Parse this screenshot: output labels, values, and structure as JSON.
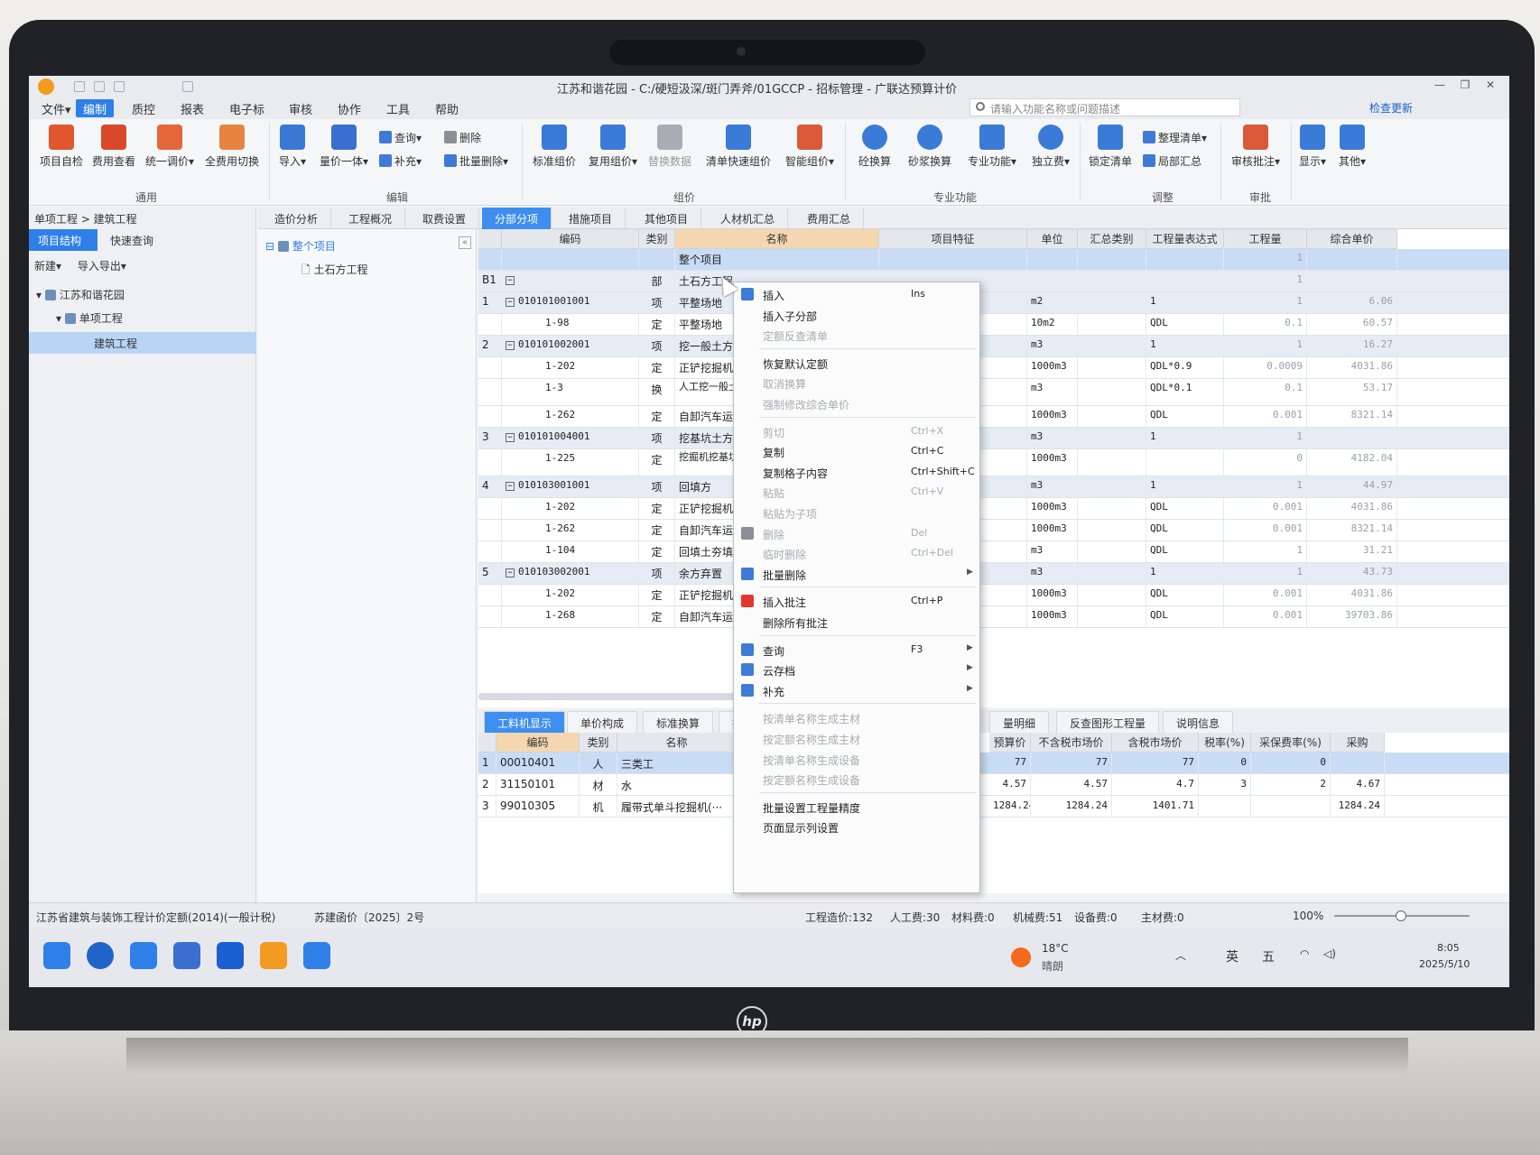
{
  "window": {
    "title": "江苏和谐花园 - C:/硬短汲深/斑门弄斧/01GCCP - 招标管理 - 广联达预算计价"
  },
  "menu": [
    "文件▾",
    "编制",
    "质控",
    "报表",
    "电子标",
    "审核",
    "协作",
    "工具",
    "帮助"
  ],
  "search": {
    "placeholder": "请输入功能名称或问题描述"
  },
  "update_label": "检查更新",
  "ribbon": {
    "tongyong": [
      "项目自检",
      "费用查看",
      "统一调价▾",
      "全费用切换"
    ],
    "import": "导入▾",
    "liangjia": "量价一体▾",
    "small_edit": [
      "查询▾",
      "补充▾",
      "删除",
      "批量删除▾"
    ],
    "zujia": [
      "标准组价",
      "复用组价▾",
      "替换数据",
      "清单快速组价",
      "智能组价▾"
    ],
    "zhuanye": [
      "砼换算",
      "砂浆换算",
      "专业功能▾",
      "独立费▾"
    ],
    "tiaozheng": [
      "锁定清单",
      "整理清单▾",
      "局部汇总"
    ],
    "shenpi": "审核批注▾",
    "view": [
      "显示▾",
      "其他▾"
    ],
    "groups": [
      "通用",
      "编辑",
      "组价",
      "专业功能",
      "调整",
      "审批"
    ]
  },
  "left": {
    "breadcrumb": "单项工程 > 建筑工程",
    "tabs": [
      "项目结构",
      "快速查询"
    ],
    "tools": [
      "新建▾",
      "导入导出▾"
    ],
    "tree": [
      "江苏和谐花园",
      "单项工程",
      "建筑工程"
    ]
  },
  "mid_tree": [
    "整个项目",
    "土石方工程"
  ],
  "doc_tabs": [
    "造价分析",
    "工程概况",
    "取费设置",
    "分部分项",
    "措施项目",
    "其他项目",
    "人材机汇总",
    "费用汇总"
  ],
  "grid": {
    "headers": [
      "编码",
      "类别",
      "名称",
      "项目特征",
      "单位",
      "汇总类别",
      "工程量表达式",
      "工程量",
      "综合单价"
    ],
    "rows": [
      {
        "no": "",
        "code": "",
        "cat": "",
        "name": "整个项目",
        "unit": "",
        "expr": "",
        "qty": "1",
        "price": "",
        "kind": "sel"
      },
      {
        "no": "B1",
        "code": "",
        "cat": "部",
        "name": "土石方工程",
        "unit": "",
        "expr": "",
        "qty": "1",
        "price": "",
        "kind": "summary"
      },
      {
        "no": "1",
        "code": "010101001001",
        "cat": "项",
        "name": "平整场地",
        "unit": "m2",
        "expr": "1",
        "qty": "1",
        "price": "6.06",
        "kind": "summary"
      },
      {
        "no": "",
        "code": "1-98",
        "cat": "定",
        "name": "平整场地",
        "unit": "10m2",
        "expr": "QDL",
        "qty": "0.1",
        "price": "60.57",
        "kind": ""
      },
      {
        "no": "2",
        "code": "010101002001",
        "cat": "项",
        "name": "挖一般土方",
        "unit": "m3",
        "expr": "1",
        "qty": "1",
        "price": "16.27",
        "kind": "summary"
      },
      {
        "no": "",
        "code": "1-202",
        "cat": "定",
        "name": "正铲挖掘机(1m3以",
        "unit": "1000m3",
        "expr": "QDL*0.9",
        "qty": "0.0009",
        "price": "4031.86",
        "kind": ""
      },
      {
        "no": "",
        "code": "1-3",
        "cat": "换",
        "name": "人工挖一般土方 坡、整平的土方工",
        "unit": "m3",
        "expr": "QDL*0.1",
        "qty": "0.1",
        "price": "53.17",
        "kind": "tall"
      },
      {
        "no": "",
        "code": "1-262",
        "cat": "定",
        "name": "自卸汽车运土运距",
        "unit": "1000m3",
        "expr": "QDL",
        "qty": "0.001",
        "price": "8321.14",
        "kind": ""
      },
      {
        "no": "3",
        "code": "010101004001",
        "cat": "项",
        "name": "挖基坑土方",
        "unit": "m3",
        "expr": "1",
        "qty": "1",
        "price": "",
        "kind": "summary"
      },
      {
        "no": "",
        "code": "1-225",
        "cat": "定",
        "name": "挖掘机挖基坑土 装车",
        "unit": "1000m3",
        "expr": "",
        "qty": "0",
        "price": "4182.04",
        "kind": "tall"
      },
      {
        "no": "4",
        "code": "010103001001",
        "cat": "项",
        "name": "回填方",
        "unit": "m3",
        "expr": "1",
        "qty": "1",
        "price": "44.97",
        "kind": "summary"
      },
      {
        "no": "",
        "code": "1-202",
        "cat": "定",
        "name": "正铲挖掘机(1m3以",
        "unit": "1000m3",
        "expr": "QDL",
        "qty": "0.001",
        "price": "4031.86",
        "kind": ""
      },
      {
        "no": "",
        "code": "1-262",
        "cat": "定",
        "name": "自卸汽车运土运距",
        "unit": "1000m3",
        "expr": "QDL",
        "qty": "0.001",
        "price": "8321.14",
        "kind": ""
      },
      {
        "no": "",
        "code": "1-104",
        "cat": "定",
        "name": "回填土夯填基(槽)",
        "unit": "m3",
        "expr": "QDL",
        "qty": "1",
        "price": "31.21",
        "kind": ""
      },
      {
        "no": "5",
        "code": "010103002001",
        "cat": "项",
        "name": "余方弃置",
        "unit": "m3",
        "expr": "1",
        "qty": "1",
        "price": "43.73",
        "kind": "summary"
      },
      {
        "no": "",
        "code": "1-202",
        "cat": "定",
        "name": "正铲挖掘机(1m3以",
        "unit": "1000m3",
        "expr": "QDL",
        "qty": "0.001",
        "price": "4031.86",
        "kind": ""
      },
      {
        "no": "",
        "code": "1-268",
        "cat": "定",
        "name": "自卸汽车运土运距",
        "unit": "1000m3",
        "expr": "QDL",
        "qty": "0.001",
        "price": "39703.86",
        "kind": ""
      }
    ]
  },
  "bottom": {
    "tabs": [
      "工料机显示",
      "单价构成",
      "标准换算",
      "换",
      "量明细",
      "反查图形工程量",
      "说明信息"
    ],
    "headers": [
      "编码",
      "类别",
      "名称",
      "预算价",
      "不含税市场价",
      "含税市场价",
      "税率(%)",
      "采保费率(%)",
      "采购"
    ],
    "rows": [
      {
        "no": "1",
        "code": "00010401",
        "cat": "人",
        "name": "三类工",
        "budget": "77",
        "mkt": "77",
        "mkt_tax": "77",
        "rate": "0",
        "fee": "0",
        "buy": "",
        "sel": true
      },
      {
        "no": "2",
        "code": "31150101",
        "cat": "材",
        "name": "水",
        "budget": "4.57",
        "mkt": "4.57",
        "mkt_tax": "4.7",
        "rate": "3",
        "fee": "2",
        "buy": "4.67",
        "sel": false
      },
      {
        "no": "3",
        "code": "99010305",
        "cat": "机",
        "name": "履带式单斗挖掘机(···",
        "budget": "1284.24",
        "mkt": "1284.24",
        "mkt_tax": "1401.71",
        "rate": "",
        "fee": "",
        "buy": "1284.24",
        "sel": false
      }
    ]
  },
  "context_menu": [
    {
      "label": "插入",
      "shortcut": "Ins",
      "disabled": false,
      "arrow": false,
      "icon": "insert-icon"
    },
    {
      "label": "插入子分部",
      "shortcut": "",
      "disabled": false,
      "arrow": false,
      "icon": ""
    },
    {
      "label": "定额反查清单",
      "shortcut": "",
      "disabled": true,
      "arrow": false,
      "icon": ""
    },
    {
      "sep": true
    },
    {
      "label": "恢复默认定额",
      "shortcut": "",
      "disabled": false,
      "arrow": false,
      "icon": ""
    },
    {
      "label": "取消换算",
      "shortcut": "",
      "disabled": true,
      "arrow": false,
      "icon": ""
    },
    {
      "label": "强制修改综合单价",
      "shortcut": "",
      "disabled": true,
      "arrow": false,
      "icon": ""
    },
    {
      "sep": true
    },
    {
      "label": "剪切",
      "shortcut": "Ctrl+X",
      "disabled": true,
      "arrow": false,
      "icon": ""
    },
    {
      "label": "复制",
      "shortcut": "Ctrl+C",
      "disabled": false,
      "arrow": false,
      "icon": ""
    },
    {
      "label": "复制格子内容",
      "shortcut": "Ctrl+Shift+C",
      "disabled": false,
      "arrow": false,
      "icon": ""
    },
    {
      "label": "粘贴",
      "shortcut": "Ctrl+V",
      "disabled": true,
      "arrow": false,
      "icon": ""
    },
    {
      "label": "粘贴为子项",
      "shortcut": "",
      "disabled": true,
      "arrow": false,
      "icon": ""
    },
    {
      "label": "删除",
      "shortcut": "Del",
      "disabled": true,
      "arrow": false,
      "icon": "trash-icon"
    },
    {
      "label": "临时删除",
      "shortcut": "Ctrl+Del",
      "disabled": true,
      "arrow": false,
      "icon": ""
    },
    {
      "label": "批量删除",
      "shortcut": "",
      "disabled": false,
      "arrow": true,
      "icon": "batch-delete-icon"
    },
    {
      "sep": true
    },
    {
      "label": "插入批注",
      "shortcut": "Ctrl+P",
      "disabled": false,
      "arrow": false,
      "icon": "new-note-icon"
    },
    {
      "label": "删除所有批注",
      "shortcut": "",
      "disabled": false,
      "arrow": false,
      "icon": ""
    },
    {
      "sep": true
    },
    {
      "label": "查询",
      "shortcut": "F3",
      "disabled": false,
      "arrow": true,
      "icon": "query-icon"
    },
    {
      "label": "云存档",
      "shortcut": "",
      "disabled": false,
      "arrow": true,
      "icon": "cloud-icon"
    },
    {
      "label": "补充",
      "shortcut": "",
      "disabled": false,
      "arrow": true,
      "icon": "supplement-icon"
    },
    {
      "sep": true
    },
    {
      "label": "按清单名称生成主材",
      "shortcut": "",
      "disabled": true,
      "arrow": false,
      "icon": ""
    },
    {
      "label": "按定额名称生成主材",
      "shortcut": "",
      "disabled": true,
      "arrow": false,
      "icon": ""
    },
    {
      "label": "按清单名称生成设备",
      "shortcut": "",
      "disabled": true,
      "arrow": false,
      "icon": ""
    },
    {
      "label": "按定额名称生成设备",
      "shortcut": "",
      "disabled": true,
      "arrow": false,
      "icon": ""
    },
    {
      "sep": true
    },
    {
      "label": "批量设置工程量精度",
      "shortcut": "",
      "disabled": false,
      "arrow": false,
      "icon": ""
    },
    {
      "label": "页面显示列设置",
      "shortcut": "",
      "disabled": false,
      "arrow": false,
      "icon": ""
    }
  ],
  "status": {
    "standard": "江苏省建筑与装饰工程计价定额(2014)(一般计税)",
    "doc": "苏建函价〔2025〕2号",
    "cost": "工程造价:132",
    "labor": "人工费:30",
    "material": "材料费:0",
    "machine": "机械费:51",
    "equipment": "设备费:0",
    "main_material": "主材费:0",
    "zoom": "100%"
  },
  "taskbar": {
    "weather_temp": "18°C",
    "weather_desc": "晴朗",
    "ime1": "英",
    "ime2": "五",
    "time": "8:05",
    "date": "2025/5/10"
  },
  "brand": "hp",
  "colors": {
    "accent": "#2f7fe8",
    "name_header": "#f4d7b0",
    "selected_row": "#c9dcf6"
  }
}
